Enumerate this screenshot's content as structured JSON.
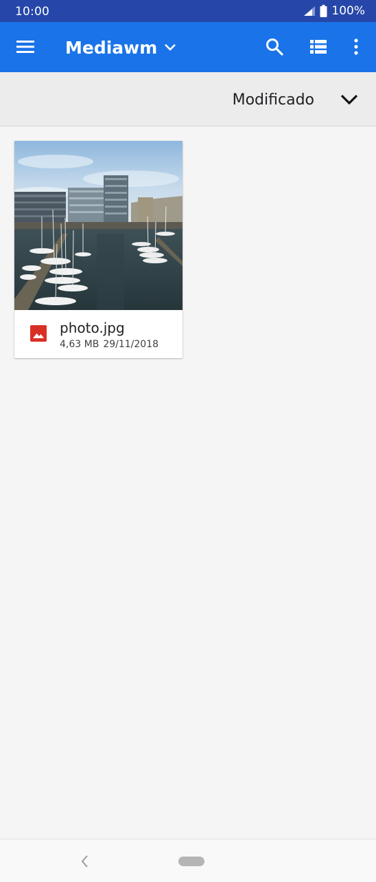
{
  "status_bar": {
    "time": "10:00",
    "battery": "100%",
    "icons": [
      "signal-icon",
      "battery-icon"
    ]
  },
  "app_bar": {
    "title": "Mediawm",
    "icons": [
      "menu-icon",
      "chevron-down-icon",
      "search-icon",
      "list-view-icon",
      "more-vert-icon"
    ],
    "color": "#1a73e8"
  },
  "sort_bar": {
    "label": "Modificado",
    "icon": "chevron-down-icon"
  },
  "files": [
    {
      "name": "photo.jpg",
      "size": "4,63 MB",
      "date": "29/11/2018",
      "type_icon": "image-icon",
      "type_icon_color": "#d93025"
    }
  ],
  "nav_bar": {
    "icons": [
      "back-icon",
      "home-pill"
    ]
  }
}
